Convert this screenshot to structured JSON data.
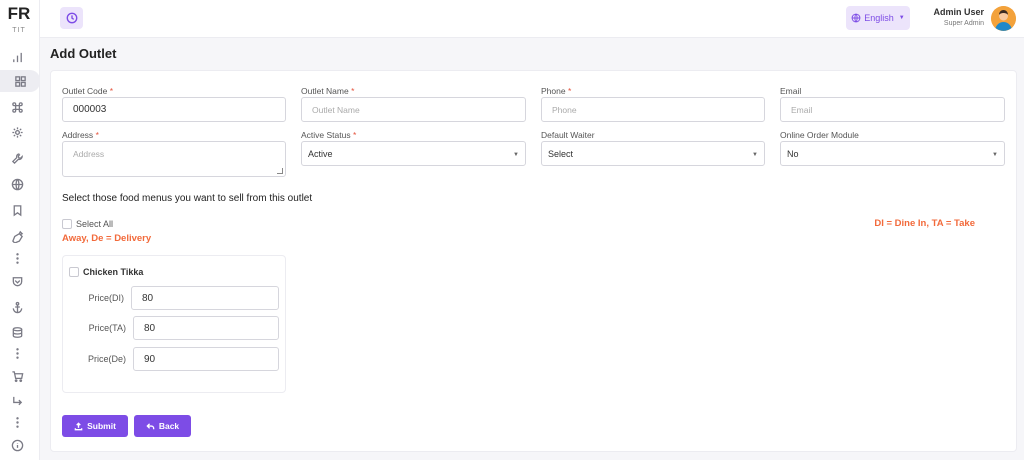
{
  "brand": {
    "logo": "FR",
    "logo_sub": "TIT"
  },
  "topbar": {
    "language": "English",
    "user_name": "Admin User",
    "user_role": "Super Admin"
  },
  "page": {
    "title": "Add Outlet"
  },
  "form": {
    "outlet_code": {
      "label": "Outlet Code",
      "value": "000003"
    },
    "outlet_name": {
      "label": "Outlet Name",
      "placeholder": "Outlet Name"
    },
    "phone": {
      "label": "Phone",
      "placeholder": "Phone"
    },
    "email": {
      "label": "Email",
      "placeholder": "Email"
    },
    "address": {
      "label": "Address",
      "placeholder": "Address"
    },
    "active_status": {
      "label": "Active Status",
      "value": "Active"
    },
    "default_waiter": {
      "label": "Default Waiter",
      "value": "Select"
    },
    "online_order": {
      "label": "Online Order Module",
      "value": "No"
    },
    "required_mark": "*"
  },
  "menus": {
    "section_title": "Select those food menus you want to sell from this outlet",
    "select_all": "Select All",
    "legend_part1": "DI = Dine In, TA = Take",
    "legend_part2": "Away, De = Delivery",
    "items": [
      {
        "name": "Chicken Tikka",
        "prices": [
          {
            "label": "Price(DI)",
            "value": "80"
          },
          {
            "label": "Price(TA)",
            "value": "80"
          },
          {
            "label": "Price(De)",
            "value": "90"
          }
        ]
      }
    ]
  },
  "actions": {
    "submit": "Submit",
    "back": "Back"
  },
  "colors": {
    "accent": "#7d4ce6",
    "accent_light": "#ece4fb",
    "legend": "#f26a3b",
    "required": "#e5533d"
  }
}
